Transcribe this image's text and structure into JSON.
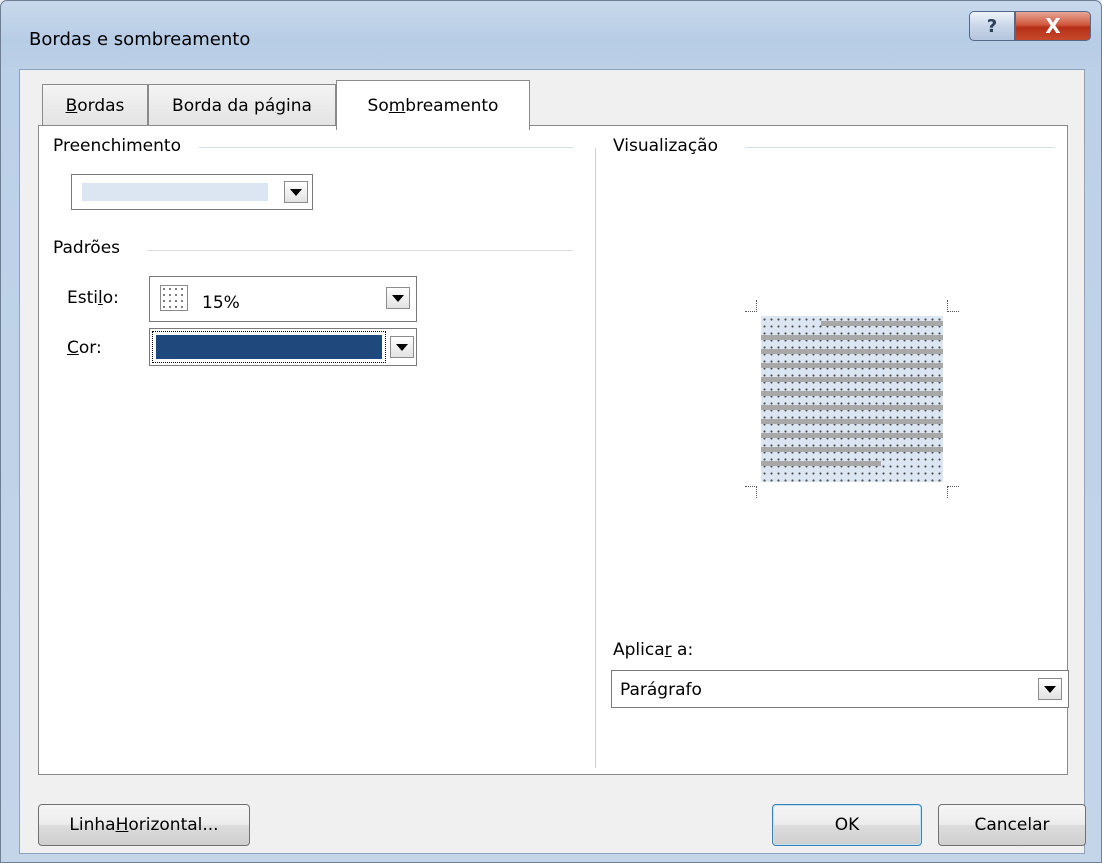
{
  "window": {
    "title": "Bordas e sombreamento",
    "help_label": "?",
    "close_label": "X"
  },
  "tabs": [
    {
      "pre": "",
      "mnemonic": "B",
      "post": "ordas"
    },
    {
      "pre": "Borda da pá",
      "mnemonic": "g",
      "post": "ina"
    },
    {
      "pre": "So",
      "mnemonic": "m",
      "post": "breamento"
    }
  ],
  "fill": {
    "label": "Preenchimento",
    "color": "#dce6f2"
  },
  "patterns": {
    "label": "Padrões",
    "style": {
      "label_pre": "Esti",
      "label_mnemonic": "l",
      "label_post": "o:",
      "value": "15%"
    },
    "color": {
      "label_pre": "",
      "label_mnemonic": "C",
      "label_post": "or:",
      "swatch_color": "#1f497d"
    }
  },
  "preview": {
    "label": "Visualização",
    "fill_color": "#dce6f2",
    "pattern_color": "#4a4a4a",
    "line_color": "#a8a8a8"
  },
  "apply_to": {
    "label_pre": "Aplica",
    "label_mnemonic": "r",
    "label_post": " a:",
    "value": "Parágrafo"
  },
  "buttons": {
    "horizontal_line": {
      "pre": "Linha ",
      "mnemonic": "H",
      "post": "orizontal..."
    },
    "ok": "OK",
    "cancel": "Cancelar"
  }
}
